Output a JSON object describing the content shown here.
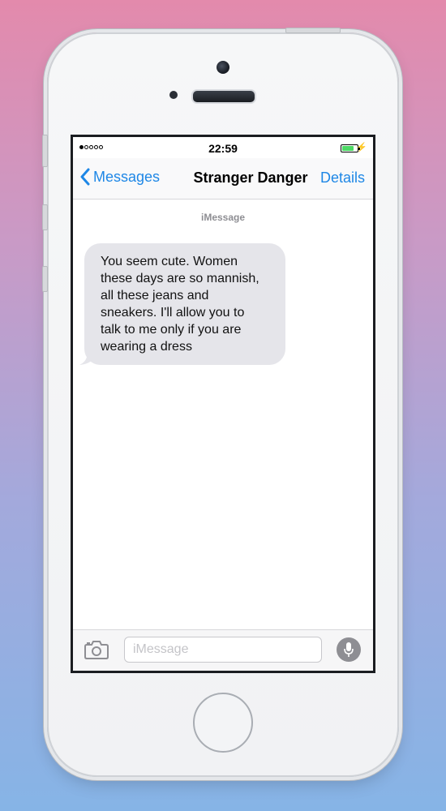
{
  "status_bar": {
    "signal_bars_filled": 1,
    "signal_bars_total": 5,
    "time": "22:59",
    "battery_level": 0.75,
    "charging": true
  },
  "nav": {
    "back_label": "Messages",
    "title": "Stranger Danger",
    "details_label": "Details"
  },
  "conversation": {
    "service_label": "iMessage",
    "messages": [
      {
        "direction": "incoming",
        "text": "You seem cute. Women\nthese days are so mannish,\nall these jeans and\nsneakers. I'll allow you to\ntalk to me only if you are\nwearing a dress"
      }
    ]
  },
  "input_bar": {
    "placeholder": "iMessage",
    "camera_icon": "camera-icon",
    "mic_icon": "microphone-icon"
  },
  "colors": {
    "accent": "#1e87e6",
    "incoming_bubble": "#e5e5ea",
    "battery_fill": "#4cd964"
  }
}
